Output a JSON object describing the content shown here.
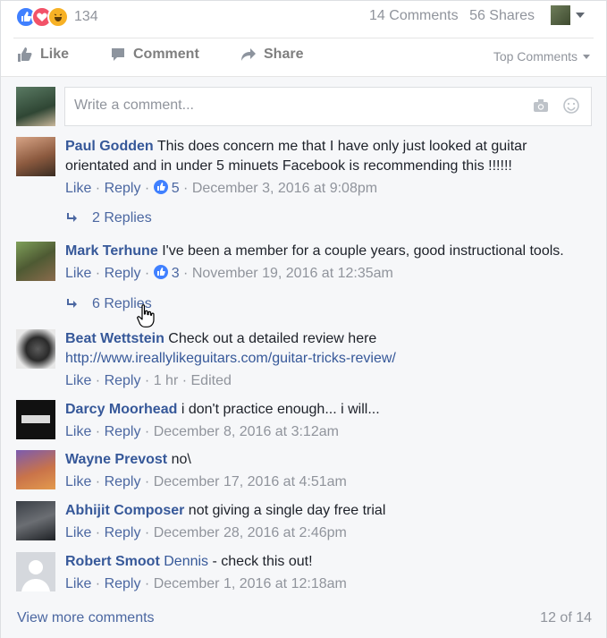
{
  "reactions": {
    "icons": [
      "like-icon",
      "love-icon",
      "haha-icon"
    ],
    "count": "134"
  },
  "stats": {
    "comments": "14 Comments",
    "shares": "56 Shares"
  },
  "actions": {
    "like": "Like",
    "comment": "Comment",
    "share": "Share",
    "sort": "Top Comments"
  },
  "writer": {
    "placeholder": "Write a comment..."
  },
  "comments": [
    {
      "author": "Paul Godden",
      "text": "This does concern me that I have only just looked at guitar orientated and in under 5 minuets Facebook is recommending this !!!!!!",
      "like": "Like",
      "reply": "Reply",
      "likes": "5",
      "time": "December 3, 2016 at 9:08pm",
      "replies": "2 Replies"
    },
    {
      "author": "Mark Terhune",
      "text": "I've been a member for a couple years, good instructional tools.",
      "like": "Like",
      "reply": "Reply",
      "likes": "3",
      "time": "November 19, 2016 at 12:35am",
      "replies": "6 Replies"
    },
    {
      "author": "Beat Wettstein",
      "text": "Check out a detailed review here",
      "link": "http://www.ireallylikeguitars.com/guitar-tricks-review/",
      "like": "Like",
      "reply": "Reply",
      "time": "1 hr",
      "edited": "Edited"
    },
    {
      "author": "Darcy Moorhead",
      "text": "i don't practice enough... i will...",
      "like": "Like",
      "reply": "Reply",
      "time": "December 8, 2016 at 3:12am"
    },
    {
      "author": "Wayne Prevost",
      "text": "no\\",
      "like": "Like",
      "reply": "Reply",
      "time": "December 17, 2016 at 4:51am"
    },
    {
      "author": "Abhijit Composer",
      "text": "not giving a single day free trial",
      "like": "Like",
      "reply": "Reply",
      "time": "December 28, 2016 at 2:46pm"
    },
    {
      "author": "Robert Smoot",
      "mention": "Dennis",
      "text": "- check this out!",
      "like": "Like",
      "reply": "Reply",
      "time": "December 1, 2016 at 12:18am"
    }
  ],
  "footer": {
    "more": "View more comments",
    "count": "12 of 14"
  },
  "colors": {
    "link": "#365899",
    "meta": "#90949c",
    "like_blue": "#4080ff",
    "love_red": "#f25268",
    "haha_yellow": "#f7b125"
  }
}
